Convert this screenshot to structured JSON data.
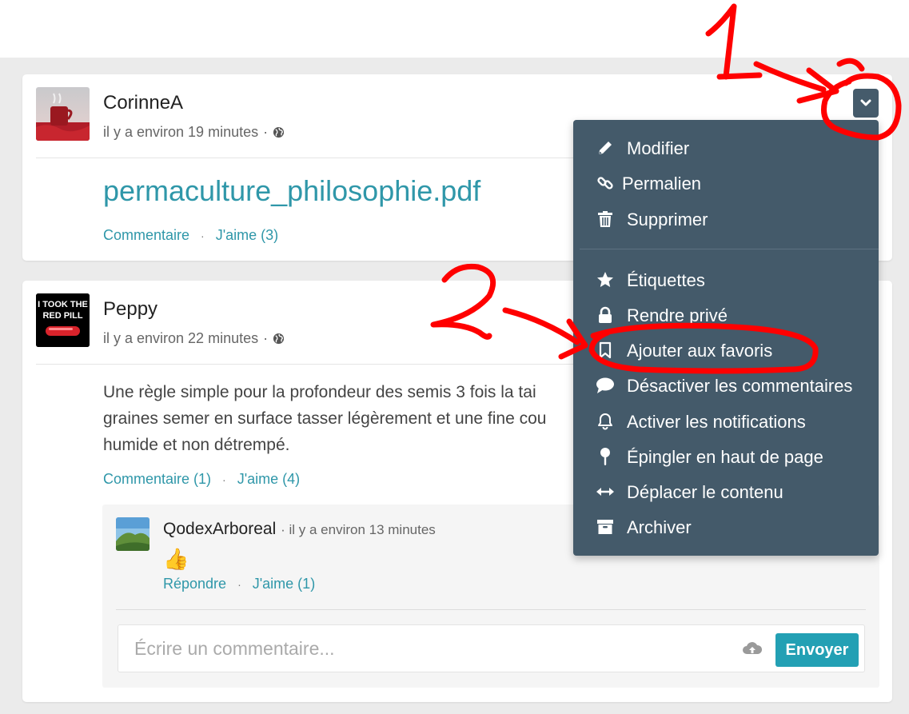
{
  "posts": [
    {
      "author": "CorinneA",
      "time": "il y a environ 19 minutes",
      "separator": "·",
      "link_title": "permaculture_philosophie.pdf",
      "actions": {
        "comment": "Commentaire",
        "like": "J'aime (3)"
      }
    },
    {
      "author": "Peppy",
      "time": "il y a environ 22 minutes",
      "separator": "·",
      "avatar_text": [
        "I TOOK THE",
        "RED PILL"
      ],
      "text_lines": [
        "Une règle simple pour la profondeur des semis 3 fois la tai",
        "graines semer en surface tasser légèrement et une fine cou",
        "humide et non détrempé."
      ],
      "actions": {
        "comment": "Commentaire (1)",
        "like": "J'aime (4)"
      },
      "comment": {
        "author": "QodexArboreal",
        "time": "· il y a environ 13 minutes",
        "emoji": "👍",
        "actions": {
          "reply": "Répondre",
          "like": "J'aime (1)"
        }
      },
      "composer": {
        "placeholder": "Écrire un commentaire...",
        "send_label": "Envoyer"
      }
    }
  ],
  "action_dot": "·",
  "menu": {
    "items": [
      {
        "label": "Modifier",
        "icon": "pencil-icon"
      },
      {
        "label": "Permalien",
        "icon": "link-icon"
      },
      {
        "label": "Supprimer",
        "icon": "trash-icon"
      },
      {
        "label": "Étiquettes",
        "icon": "star-icon"
      },
      {
        "label": "Rendre privé",
        "icon": "lock-icon"
      },
      {
        "label": "Ajouter aux favoris",
        "icon": "bookmark-icon"
      },
      {
        "label": "Désactiver les commentaires",
        "icon": "comment-icon"
      },
      {
        "label": "Activer les notifications",
        "icon": "bell-icon"
      },
      {
        "label": "Épingler en haut de page",
        "icon": "pin-icon"
      },
      {
        "label": "Déplacer le contenu",
        "icon": "arrows-horizontal-icon"
      },
      {
        "label": "Archiver",
        "icon": "archive-icon"
      }
    ]
  },
  "annotations": {
    "step1": "1",
    "step2": "2"
  },
  "colors": {
    "accent": "#2f97a9",
    "menu_bg": "#445a6a",
    "send_button": "#23a0b4",
    "annotation": "#ff0000"
  }
}
